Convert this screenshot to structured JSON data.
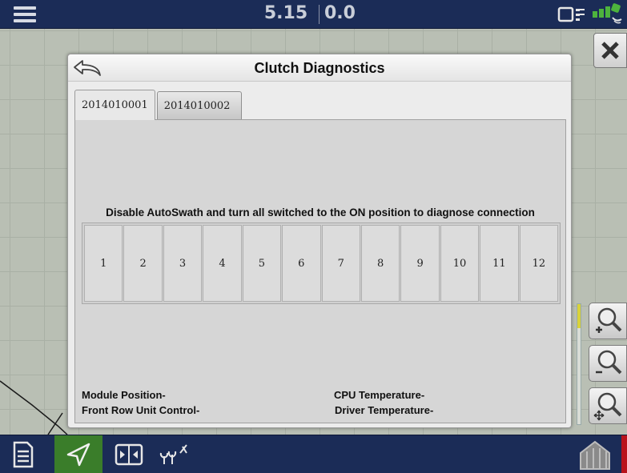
{
  "topbar": {
    "primary_readout": "5.15",
    "secondary_readout": "0.0",
    "icons": [
      "menu-icon",
      "device-status-icon",
      "gps-signal-icon"
    ]
  },
  "dialog": {
    "title": "Clutch Diagnostics",
    "tabs": [
      {
        "label": "2014010001",
        "active": true
      },
      {
        "label": "2014010002",
        "active": false
      }
    ],
    "instruction": "Disable AutoSwath and turn all switched to the ON position to diagnose connection",
    "clutches": [
      "1",
      "2",
      "3",
      "4",
      "5",
      "6",
      "7",
      "8",
      "9",
      "10",
      "11",
      "12"
    ],
    "module_position_label": "Module Position-",
    "front_row_label": "Front Row Unit Control-",
    "cpu_temp_label": "CPU Temperature-",
    "driver_temp_label": "Driver Temperature-"
  },
  "colors": {
    "bar_background": "#1b2c57",
    "active_nav": "#3a7d2a",
    "accent_red": "#b8121b",
    "zoom_fill": "#d8d23a"
  }
}
